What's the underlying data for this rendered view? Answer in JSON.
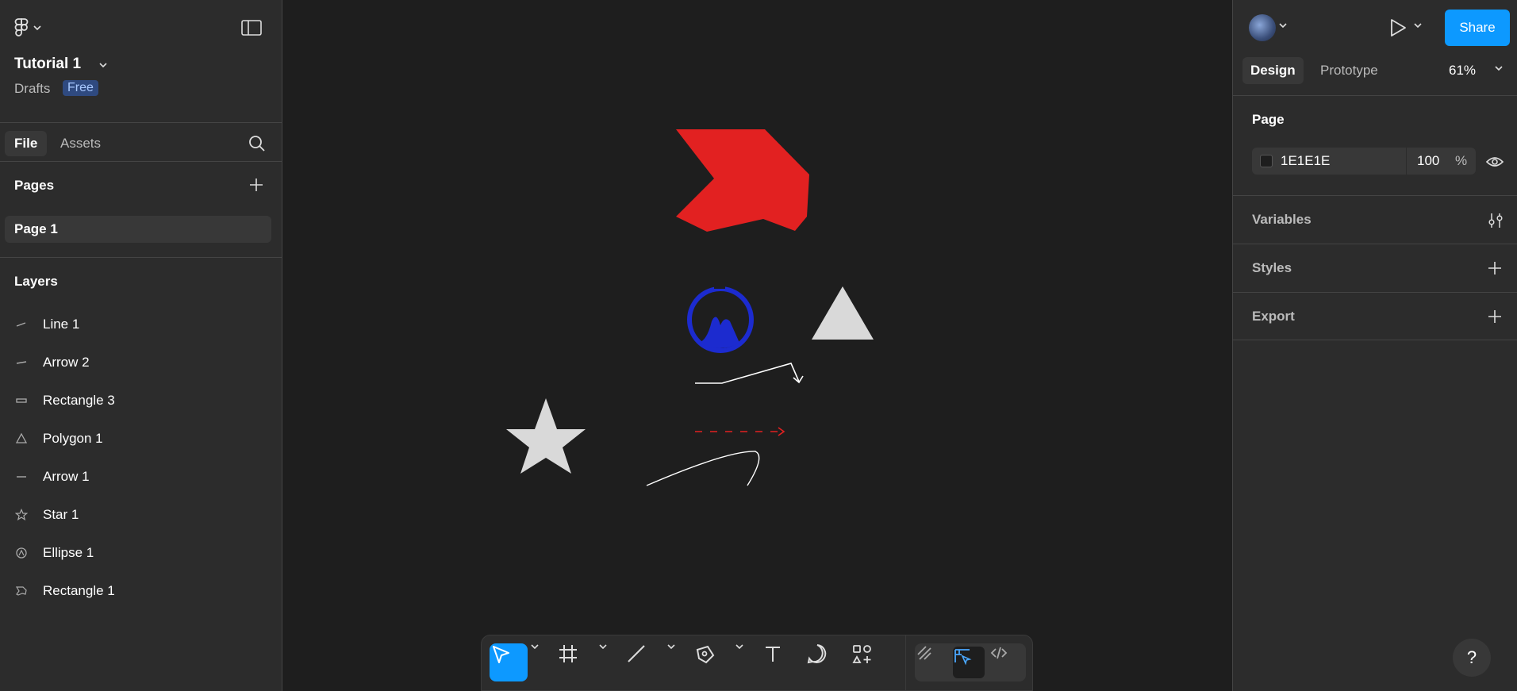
{
  "file": {
    "title": "Tutorial 1",
    "location": "Drafts",
    "plan": "Free"
  },
  "left_tabs": {
    "file": "File",
    "assets": "Assets"
  },
  "pages": {
    "header": "Pages",
    "items": [
      {
        "label": "Page 1"
      }
    ]
  },
  "layers": {
    "header": "Layers",
    "items": [
      {
        "label": "Line 1",
        "icon": "line-icon"
      },
      {
        "label": "Arrow 2",
        "icon": "arrow-icon"
      },
      {
        "label": "Rectangle 3",
        "icon": "rectangle-icon"
      },
      {
        "label": "Polygon 1",
        "icon": "polygon-icon"
      },
      {
        "label": "Arrow 1",
        "icon": "arrow-icon"
      },
      {
        "label": "Star 1",
        "icon": "star-icon"
      },
      {
        "label": "Ellipse 1",
        "icon": "ellipse-icon"
      },
      {
        "label": "Rectangle 1",
        "icon": "vector-icon"
      }
    ]
  },
  "right": {
    "share": "Share",
    "tabs": {
      "design": "Design",
      "prototype": "Prototype"
    },
    "zoom": "61%",
    "page_section": {
      "title": "Page",
      "color": "1E1E1E",
      "opacity": "100",
      "percent": "%"
    },
    "variables": "Variables",
    "styles": "Styles",
    "export": "Export",
    "help": "?"
  },
  "colors": {
    "canvas": "#1e1e1e",
    "panel": "#2c2c2c",
    "accent": "#0d99ff",
    "red_shape": "#e22121",
    "blue_shape": "#1c2bcf",
    "gray_shape": "#d9d9d9"
  },
  "toolbar": {
    "tools": [
      "move-icon",
      "frame-icon",
      "line-icon",
      "pen-icon",
      "text-icon",
      "comment-icon",
      "actions-icon",
      "draw-icon",
      "design-mode-icon",
      "dev-mode-icon"
    ]
  }
}
